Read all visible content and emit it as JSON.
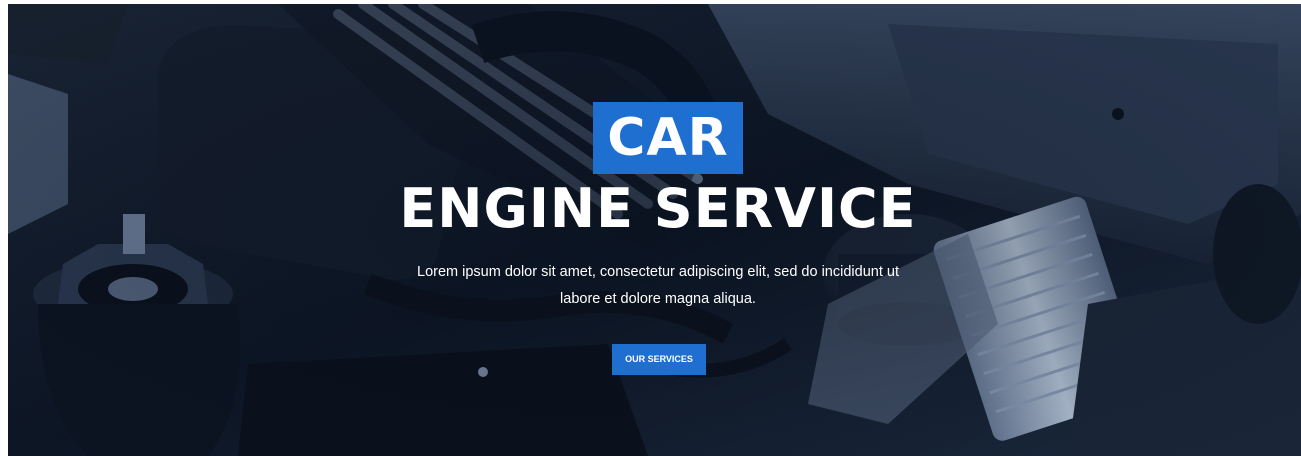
{
  "hero": {
    "title_highlight": "CAR",
    "title_main": "ENGINE SERVICE",
    "subtitle": "Lorem ipsum dolor sit amet, consectetur adipiscing elit, sed do incididunt ut labore et dolore magna aliqua.",
    "cta_label": "OUR SERVICES",
    "background_image": "car-engine-bay-photo"
  },
  "colors": {
    "accent": "#1f6fd0",
    "text": "#ffffff",
    "overlay": "#0a1422"
  }
}
